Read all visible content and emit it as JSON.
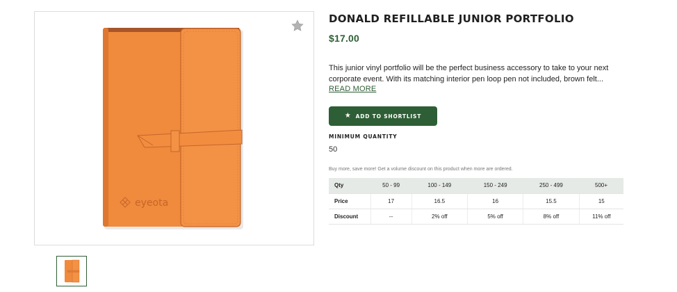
{
  "product": {
    "title": "DONALD REFILLABLE JUNIOR PORTFOLIO",
    "price": "$17.00",
    "description": "This junior vinyl portfolio will be the perfect business accessory to take to your next corporate event. With its matching interior pen loop pen not included, brown felt...",
    "read_more": "READ MORE",
    "shortlist_label": "ADD TO SHORTLIST",
    "min_quantity_label": "MINIMUM QUANTITY",
    "min_quantity_value": "50",
    "volume_note": "Buy more, save more! Get a volume discount on this product when more are ordered.",
    "image_logo_text": "eyeota"
  },
  "pricing": {
    "header": [
      "Qty",
      "50 - 99",
      "100 - 149",
      "150 - 249",
      "250 - 499",
      "500+"
    ],
    "price_row": [
      "Price",
      "17",
      "16.5",
      "16",
      "15.5",
      "15"
    ],
    "discount_row": [
      "Discount",
      "--",
      "2% off",
      "5% off",
      "8% off",
      "11% off"
    ]
  },
  "colors": {
    "brand_green": "#2e5e35",
    "portfolio_orange": "#f08a3c",
    "table_header_bg": "#e6eae7"
  },
  "icons": {
    "favorite": "star-icon",
    "shortlist": "star-icon"
  }
}
